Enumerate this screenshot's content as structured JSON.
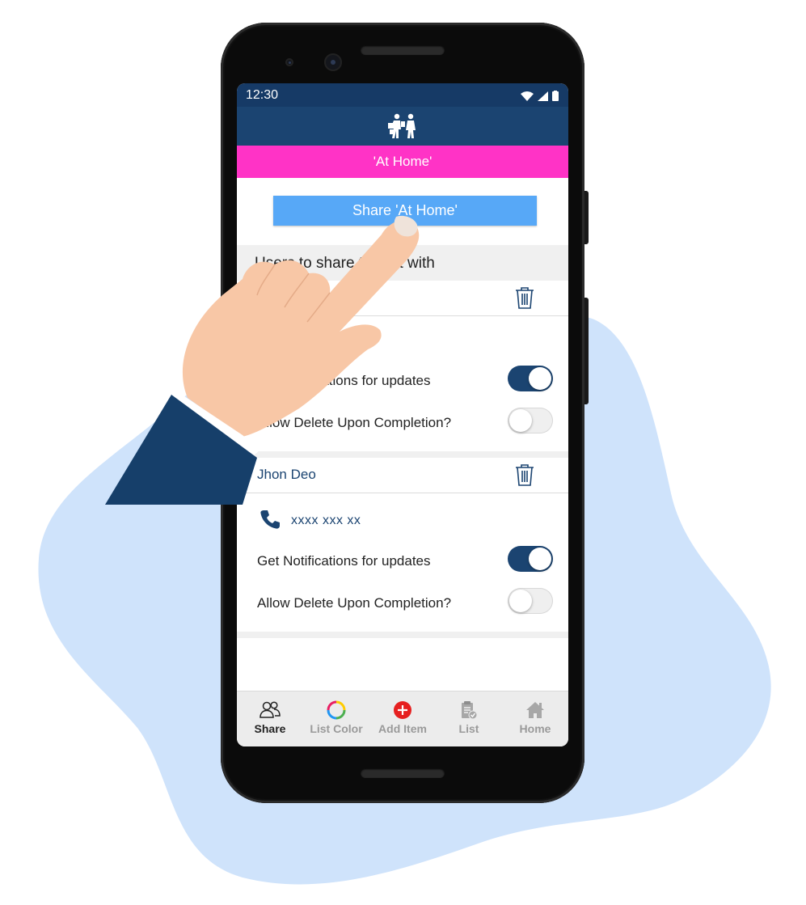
{
  "status_bar": {
    "time": "12:30"
  },
  "list_banner": {
    "title": "'At Home'"
  },
  "share_button": {
    "label": "Share 'At Home'"
  },
  "users_section": {
    "heading": "Users to share the list with"
  },
  "shared_users": [
    {
      "name": "",
      "phone": "",
      "notifications_label": "Get Notifications for updates",
      "notifications_on": true,
      "allow_delete_label": "Allow Delete Upon Completion?",
      "allow_delete_on": false
    },
    {
      "name": "Jhon Deo",
      "phone": "xxxx xxx xx",
      "notifications_label": "Get Notifications for updates",
      "notifications_on": true,
      "allow_delete_label": "Allow Delete Upon Completion?",
      "allow_delete_on": false
    }
  ],
  "tabs": [
    {
      "label": "Share",
      "icon": "people-icon",
      "active": true
    },
    {
      "label": "List Color",
      "icon": "color-ring-icon",
      "active": false
    },
    {
      "label": "Add Item",
      "icon": "plus-circle-icon",
      "active": false
    },
    {
      "label": "List",
      "icon": "clipboard-check-icon",
      "active": false
    },
    {
      "label": "Home",
      "icon": "house-icon",
      "active": false
    }
  ],
  "colors": {
    "app_bar": "#1b4471",
    "list_banner": "#ff33c6",
    "share_button": "#57a8f7",
    "toggle_on": "#1b4471",
    "add_item": "#e62020",
    "background_blob": "#cfe3fb"
  }
}
